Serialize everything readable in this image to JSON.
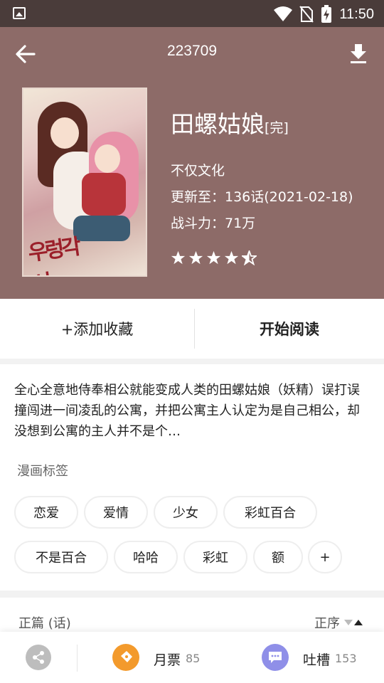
{
  "status_bar": {
    "time": "11:50",
    "icons": [
      "image-icon",
      "wifi-icon",
      "no-sim-icon",
      "battery-charging-icon"
    ]
  },
  "header": {
    "title": "223709",
    "back_icon": "arrow-left-icon",
    "download_icon": "download-icon",
    "background_color": "#8d6b68"
  },
  "comic": {
    "title": "田螺姑娘",
    "status": "[完]",
    "publisher": "不仅文化",
    "update": "更新至：136话(2021-02-18)",
    "power": "战斗力：71万",
    "cover_logo": "우렁각시",
    "rating": 4.5,
    "rating_max": 5
  },
  "actions": {
    "add_favorite": "+添加收藏",
    "start_reading": "开始阅读"
  },
  "description": "全心全意地侍奉相公就能变成人类的田螺姑娘（妖精）误打误撞闯进一间凌乱的公寓，并把公寓主人认定为是自己相公，却没想到公寓的主人并不是个…",
  "tags": {
    "label": "漫画标签",
    "items": [
      "恋爱",
      "爱情",
      "少女",
      "彩虹百合",
      "不是百合",
      "哈哈",
      "彩虹",
      "额",
      "+"
    ]
  },
  "chapters": {
    "label": "正篇 (话)",
    "order": "正序"
  },
  "bottom_bar": {
    "ticket_label": "月票",
    "ticket_count": "85",
    "comment_label": "吐槽",
    "comment_count": "153",
    "ticket_color": "#f39a2c",
    "comment_color": "#8f8fe8"
  }
}
